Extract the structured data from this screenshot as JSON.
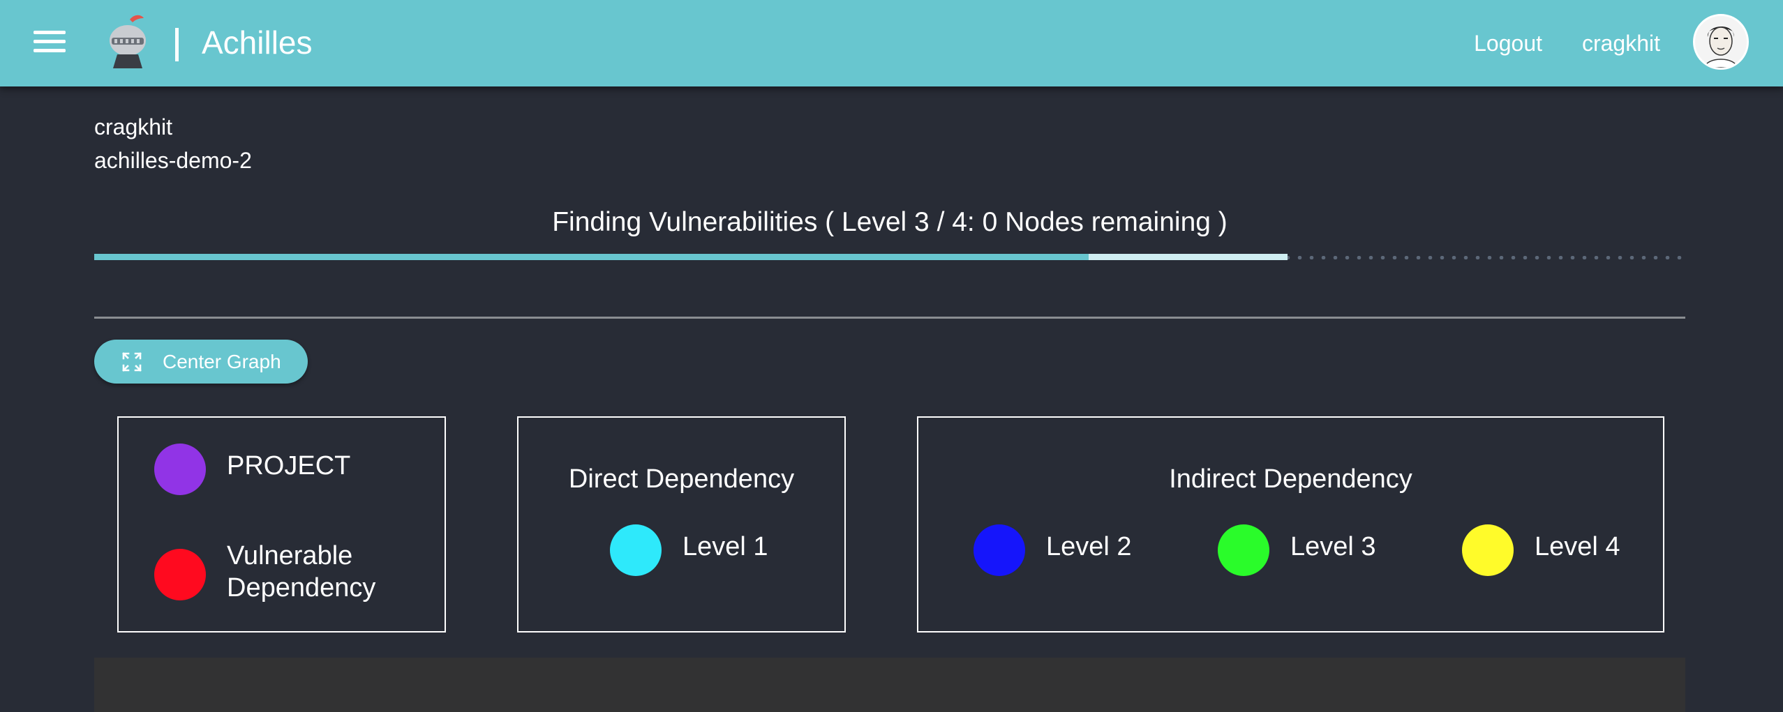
{
  "header": {
    "app_title": "Achilles",
    "logout_label": "Logout",
    "username": "cragkhit",
    "icons": {
      "menu": "hamburger-icon",
      "logo": "knight-helmet-logo",
      "avatar": "user-avatar"
    },
    "colors": {
      "bar": "#68c6cf",
      "page_bg": "#282c36"
    }
  },
  "breadcrumb": {
    "user": "cragkhit",
    "project": "achilles-demo-2"
  },
  "status": {
    "text": "Finding Vulnerabilities ( Level 3 / 4: 0 Nodes remaining )",
    "progress_value": 0.625,
    "progress_buffer": 0.75
  },
  "toolbar": {
    "center_graph_label": "Center Graph",
    "center_graph_icon": "expand-arrows-icon"
  },
  "legend": {
    "general": [
      {
        "label": "PROJECT",
        "color": "#9134e6"
      },
      {
        "label": "Vulnerable Dependency",
        "color": "#ff0a1f"
      }
    ],
    "direct": {
      "title": "Direct Dependency",
      "items": [
        {
          "label": "Level 1",
          "color": "#2ee9fb"
        }
      ]
    },
    "indirect": {
      "title": "Indirect Dependency",
      "items": [
        {
          "label": "Level 2",
          "color": "#1515fb"
        },
        {
          "label": "Level 3",
          "color": "#2afc2a"
        },
        {
          "label": "Level 4",
          "color": "#fffb2a"
        }
      ]
    }
  }
}
